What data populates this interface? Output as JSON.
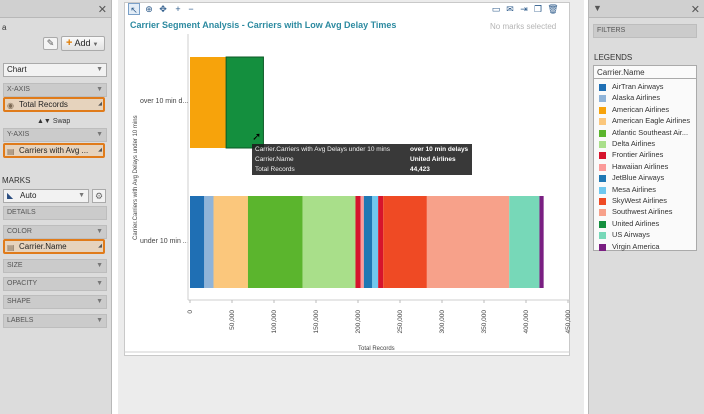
{
  "left_panel": {
    "partial_text": "a",
    "add_label": "Add",
    "chart_type": "Chart",
    "x_axis_label": "X-AXIS",
    "x_axis_field": "Total Records",
    "swap_label": "Swap",
    "y_axis_label": "Y-AXIS",
    "y_axis_field": "Carriers with Avg ...",
    "marks_label": "MARKS",
    "marks_type": "Auto",
    "sections": [
      "DETAILS",
      "COLOR",
      "SIZE",
      "OPACITY",
      "SHAPE",
      "LABELS"
    ],
    "color_field": "Carrier.Name"
  },
  "chart": {
    "title": "Carrier Segment Analysis - Carriers with Low Avg Delay Times",
    "no_marks": "No marks selected",
    "y_axis_title": "Carrier.Carriers with Avg Delays under 10 mins",
    "x_axis_title": "Total Records",
    "tooltip": {
      "rows": [
        {
          "key": "Carrier.Carriers with Avg Delays under 10 mins",
          "value": "over 10 min delays"
        },
        {
          "key": "Carrier.Name",
          "value": "United Airlines"
        },
        {
          "key": "Total Records",
          "value": "44,423"
        }
      ]
    }
  },
  "chart_data": {
    "type": "bar",
    "orientation": "horizontal",
    "stacked": true,
    "title": "Carrier Segment Analysis - Carriers with Low Avg Delay Times",
    "xlabel": "Total Records",
    "ylabel": "Carrier.Carriers with Avg Delays under 10 mins",
    "xlim": [
      0,
      450000
    ],
    "xticks": [
      "0",
      "50,000",
      "100,000",
      "150,000",
      "200,000",
      "250,000",
      "300,000",
      "350,000",
      "400,000",
      "450,000"
    ],
    "categories": [
      "over 10 min d...",
      "under 10 min ..."
    ],
    "series": [
      {
        "name": "AirTran Airways",
        "color": "#1f6fb4",
        "values": [
          0,
          17000
        ]
      },
      {
        "name": "Alaska Airlines",
        "color": "#8fb4d9",
        "values": [
          0,
          11000
        ]
      },
      {
        "name": "American Airlines",
        "color": "#f7a30b",
        "values": [
          43000,
          0
        ]
      },
      {
        "name": "American Eagle Airlines",
        "color": "#fbc77c",
        "values": [
          0,
          41000
        ]
      },
      {
        "name": "Atlantic Southeast Airlines",
        "color": "#5bb52d",
        "values": [
          0,
          65000
        ]
      },
      {
        "name": "Delta Airlines",
        "color": "#a9df8a",
        "values": [
          0,
          63000
        ]
      },
      {
        "name": "Frontier Airlines",
        "color": "#d6142d",
        "values": [
          0,
          6000
        ]
      },
      {
        "name": "Hawaiian Airlines",
        "color": "#fb9a99",
        "values": [
          0,
          4000
        ]
      },
      {
        "name": "JetBlue Airways",
        "color": "#1f78b4",
        "values": [
          0,
          10000
        ]
      },
      {
        "name": "Mesa Airlines",
        "color": "#6fc8ef",
        "values": [
          0,
          7000
        ]
      },
      {
        "name": "SkyWest Airlines",
        "color": "#ef4a24",
        "values": [
          0,
          52000
        ]
      },
      {
        "name": "Southwest Airlines",
        "color": "#f7a18a",
        "values": [
          0,
          98000
        ]
      },
      {
        "name": "United Airlines",
        "color": "#148f3e",
        "values": [
          44423,
          0
        ]
      },
      {
        "name": "US Airways",
        "color": "#77d8b8",
        "values": [
          0,
          36000
        ]
      },
      {
        "name": "Virgin America",
        "color": "#7a1f82",
        "values": [
          0,
          5000
        ]
      }
    ],
    "bar_order": [
      [
        "American Airlines",
        "United Airlines"
      ],
      [
        "AirTran Airways",
        "Alaska Airlines",
        "American Eagle Airlines",
        "Atlantic Southeast Airlines",
        "Delta Airlines",
        "Frontier Airlines",
        "Hawaiian Airlines",
        "JetBlue Airways",
        "Mesa Airlines",
        "Frontier Airlines",
        "SkyWest Airlines",
        "Southwest Airlines",
        "US Airways",
        "Virgin America"
      ]
    ],
    "grid": false,
    "legend": "right panel"
  },
  "right_panel": {
    "filters_label": "FILTERS",
    "legends_label": "LEGENDS",
    "legend_field": "Carrier.Name",
    "legend_items": [
      {
        "label": "AirTran Airways",
        "color": "#1f6fb4"
      },
      {
        "label": "Alaska Airlines",
        "color": "#8fb4d9"
      },
      {
        "label": "American Airlines",
        "color": "#f7a30b"
      },
      {
        "label": "American Eagle Airlines",
        "color": "#fbc77c"
      },
      {
        "label": "Atlantic Southeast Air...",
        "color": "#5bb52d"
      },
      {
        "label": "Delta Airlines",
        "color": "#a9df8a"
      },
      {
        "label": "Frontier Airlines",
        "color": "#d6142d"
      },
      {
        "label": "Hawaiian Airlines",
        "color": "#fb9a99"
      },
      {
        "label": "JetBlue Airways",
        "color": "#1f78b4"
      },
      {
        "label": "Mesa Airlines",
        "color": "#6fc8ef"
      },
      {
        "label": "SkyWest Airlines",
        "color": "#ef4a24"
      },
      {
        "label": "Southwest Airlines",
        "color": "#f7a18a"
      },
      {
        "label": "United Airlines",
        "color": "#148f3e"
      },
      {
        "label": "US Airways",
        "color": "#77d8b8"
      },
      {
        "label": "Virgin America",
        "color": "#7a1f82"
      }
    ]
  }
}
